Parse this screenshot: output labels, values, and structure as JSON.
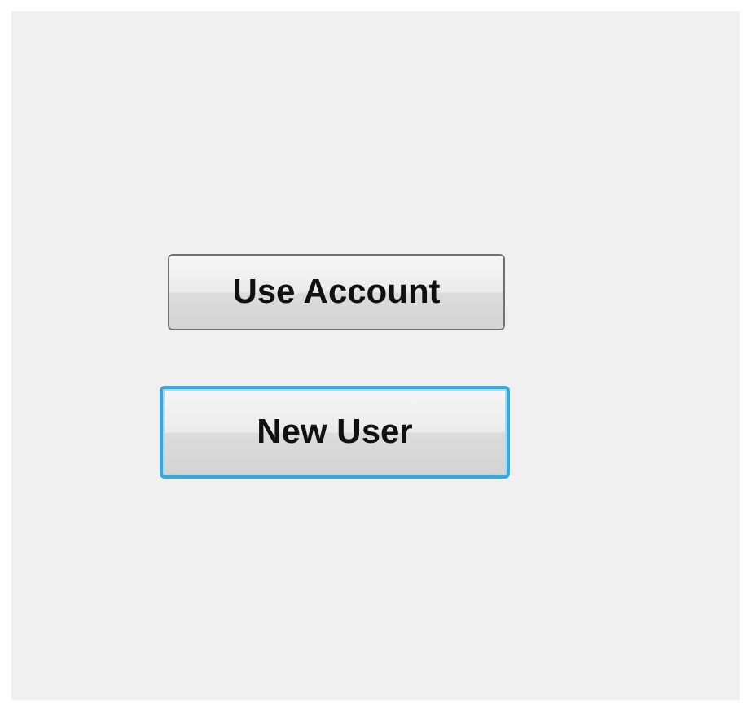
{
  "buttons": [
    {
      "label": "Use Account",
      "focused": false
    },
    {
      "label": "New User",
      "focused": true
    }
  ]
}
